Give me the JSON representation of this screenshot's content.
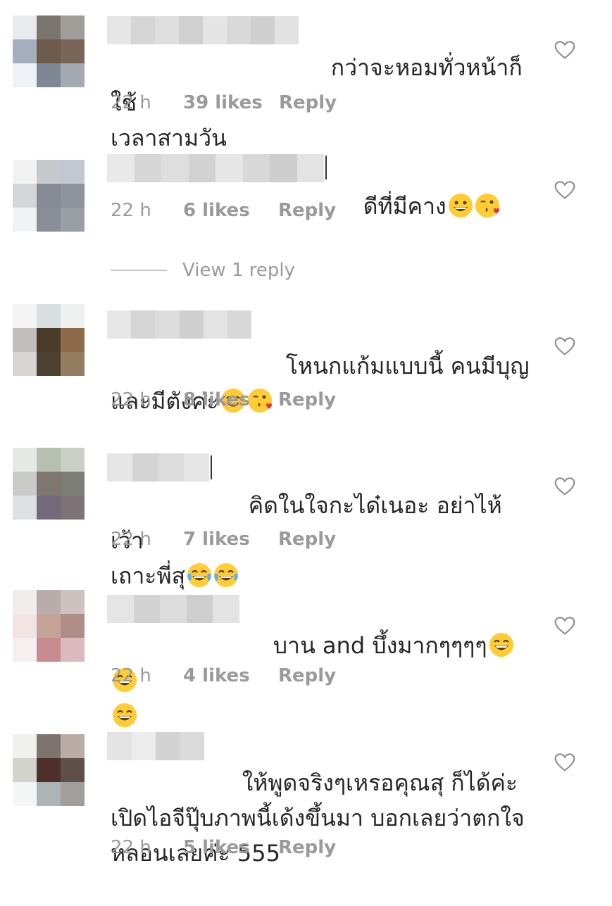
{
  "comments": [
    {
      "text": "กว่าจะหอมทั่วหน้าก็ใช้เวลาสามวัน",
      "line1": "กว่าจะหอมทั่วหน้าก็ใช้",
      "line2": "เวลาสามวัน",
      "time": "22 h",
      "likes": "39 likes",
      "reply": "Reply",
      "emojis": []
    },
    {
      "text": "ดีที่มีคาง",
      "line1": "ดีที่มีคาง",
      "time": "22 h",
      "likes": "6 likes",
      "reply": "Reply",
      "emojis": [
        "grinning-face",
        "face-blowing-kiss"
      ]
    },
    {
      "text": "โหนกแก้มแบบนี้ คนมีบุญและมีตังค่ะ",
      "line1": "โหนกแก้มแบบนี้ คนมีบุญ",
      "line2": "และมีตังค่ะ",
      "time": "22 h",
      "likes": "8 likes",
      "reply": "Reply",
      "emojis": [
        "smiling-face-smiling-eyes",
        "face-blowing-kiss"
      ]
    },
    {
      "text": "คิดในใจกะได้เนอะ อย่าให้เว้าเถาะพี่สุ",
      "line1": "คิดในใจกะได๋เนอะ อย่าไห้เว้า",
      "line2": "เถาะพี่สุ",
      "time": "22 h",
      "likes": "7 likes",
      "reply": "Reply",
      "emojis": [
        "face-tears-of-joy",
        "face-tears-of-joy"
      ]
    },
    {
      "text": "บาน and บึ้งมากๆๆๆๆ",
      "line1": "บาน and บึ้งมากๆๆๆๆ",
      "time": "22 h",
      "likes": "4 likes",
      "reply": "Reply",
      "emojis": [
        "grinning-face-smiling-eyes",
        "grinning-face-smiling-eyes",
        "grinning-face-smiling-eyes"
      ]
    },
    {
      "text": "ให้พูดจริงๆเหรอคุณสุ ก็ได้ค่ะ เปิดไอจีปุ๊บภาพนี้เด้งขึ้นมา บอกเลยว่าตกใจหลอนเลยค่ะ 555",
      "line1": "ให้พูดจริงๆเหรอคุณสุ ก็ได้ค่ะ",
      "line2": "เปิดไอจีปุ๊บภาพนี้เด้งขึ้นมา บอกเลยว่าตกใจ",
      "line3": "หลอนเลยค่ะ 555",
      "time": "22 h",
      "likes": "5 likes",
      "reply": "Reply",
      "emojis": []
    }
  ],
  "view_replies": "View 1 reply",
  "icons": {
    "heart": "heart-outline-icon",
    "avatar": "avatar-pixelated",
    "username": "username-blurred"
  },
  "colors": {
    "text": "#262626",
    "meta": "#9a9a9a",
    "heart": "#8e8e8e"
  }
}
